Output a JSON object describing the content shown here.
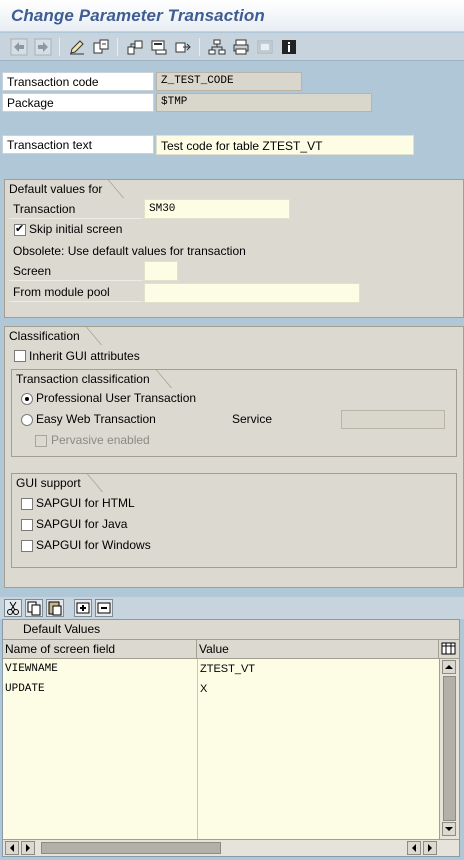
{
  "window": {
    "title": "Change Parameter Transaction"
  },
  "toolbar": {
    "icons": [
      "back-arrow-icon",
      "forward-arrow-icon",
      "display-change-icon",
      "other-object-icon",
      "check-icon",
      "activate-icon",
      "where-used-icon",
      "hierarchy-icon",
      "print-icon",
      "layout-icon",
      "info-icon"
    ]
  },
  "header_fields": {
    "transaction_code_label": "Transaction code",
    "transaction_code_value": "Z_TEST_CODE",
    "package_label": "Package",
    "package_value": "$TMP",
    "transaction_text_label": "Transaction text",
    "transaction_text_value": "Test code for table ZTEST_VT"
  },
  "defaults_group": {
    "title": "Default values for",
    "transaction_label": "Transaction",
    "transaction_value": "SM30",
    "skip_initial_label": "Skip initial screen",
    "skip_initial_checked": true,
    "obsolete_text": "Obsolete: Use default values for transaction",
    "screen_label": "Screen",
    "screen_value": "",
    "module_pool_label": "From module pool",
    "module_pool_value": ""
  },
  "classification_group": {
    "title": "Classification",
    "inherit_gui_label": "Inherit GUI attributes",
    "inherit_gui_checked": false,
    "transaction_classification": {
      "title": "Transaction classification",
      "professional_label": "Professional User Transaction",
      "professional_selected": true,
      "easy_web_label": "Easy Web Transaction",
      "easy_web_selected": false,
      "service_label": "Service",
      "service_value": "",
      "pervasive_label": "Pervasive enabled",
      "pervasive_checked": false
    },
    "gui_support": {
      "title": "GUI support",
      "html_label": "SAPGUI for HTML",
      "java_label": "SAPGUI for Java",
      "windows_label": "SAPGUI for Windows"
    }
  },
  "default_values_table": {
    "toolbar_icons": [
      "cut-icon",
      "copy-icon",
      "paste-icon",
      "insert-row-icon",
      "delete-row-icon"
    ],
    "title": "Default Values",
    "columns": [
      "Name of screen field",
      "Value"
    ],
    "rows": [
      {
        "field": "VIEWNAME",
        "value": "ZTEST_VT"
      },
      {
        "field": "UPDATE",
        "value": "X"
      }
    ]
  }
}
